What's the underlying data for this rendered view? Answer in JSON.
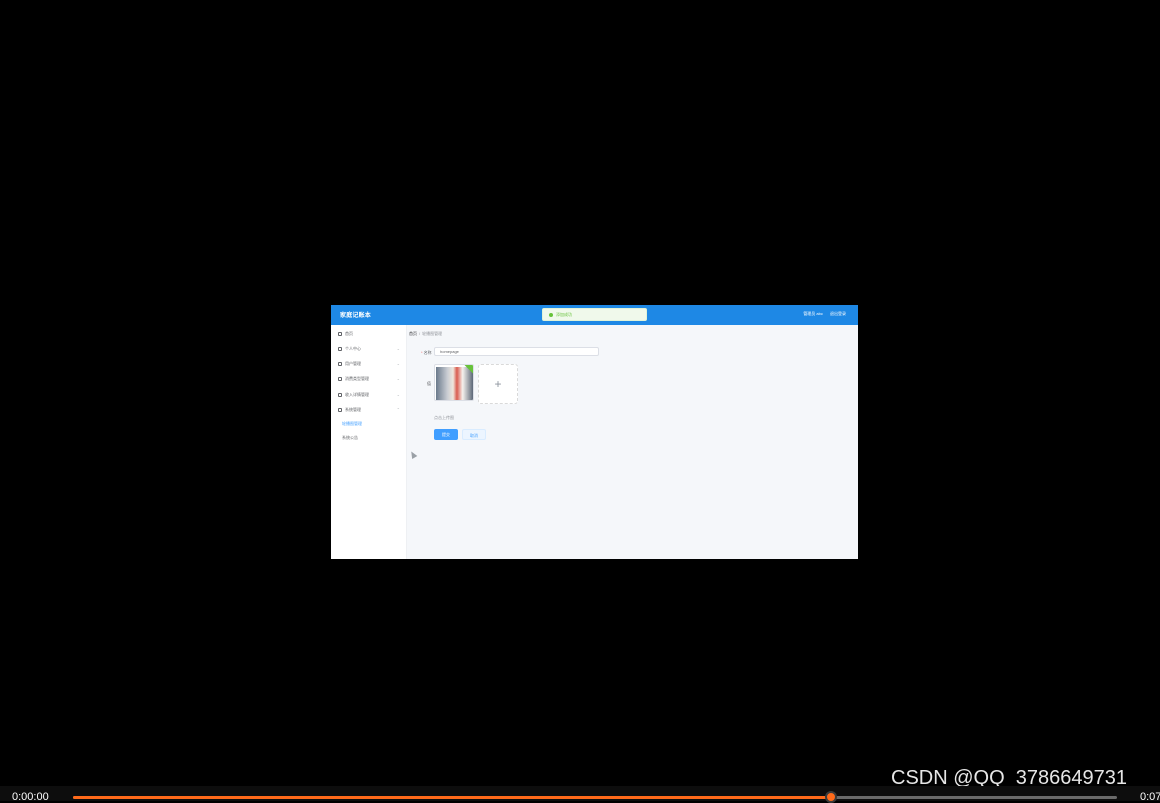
{
  "app": {
    "brand": "家庭记账本",
    "toast": "添加成功",
    "user_greeting": "管理员 abc",
    "logout": "退出登录"
  },
  "sidebar": {
    "items": [
      {
        "label": "首页",
        "icon": "home-icon"
      },
      {
        "label": "个人中心",
        "icon": "user-icon"
      },
      {
        "label": "用户管理",
        "icon": "location-icon"
      },
      {
        "label": "消费类型管理",
        "icon": "bell-icon"
      },
      {
        "label": "收入详情管理",
        "icon": "location-icon"
      },
      {
        "label": "系统管理",
        "icon": "filter-icon"
      }
    ],
    "sub_items": [
      {
        "label": "轮播图管理",
        "active": true
      },
      {
        "label": "系统公告",
        "active": false
      }
    ]
  },
  "breadcrumb": {
    "home": "首页",
    "current": "轮播图管理"
  },
  "form": {
    "name_label": "名称",
    "name_value": "homepage",
    "image_label": "值",
    "hint": "点击上传图",
    "submit": "提交",
    "cancel": "取消"
  },
  "player": {
    "current_time": "0:00:00",
    "total_time": "0:07",
    "progress": 0.726,
    "watermark": "CSDN @QQ_3786649731",
    "accent": "#ff6a1a"
  }
}
